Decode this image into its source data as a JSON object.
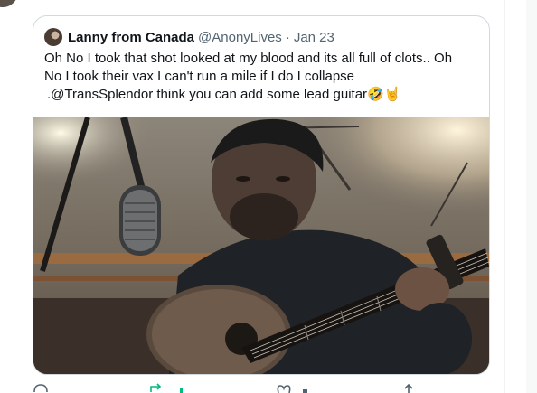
{
  "quoted_tweet": {
    "display_name": "Lanny from Canada",
    "handle": "@AnonyLives",
    "separator": "·",
    "date": "Jan 23",
    "text_lines": [
      "Oh No I took that shot looked at my blood and its all full of clots.. Oh",
      "No I took their vax I can't run a mile if I do I collapse",
      ".@TransSplendor think you can add some lead guitar"
    ],
    "emojis": "🤣🤘"
  },
  "media": {
    "description_icon": "video-thumbnail-man-with-guitar-and-microphone"
  },
  "colors": {
    "border": "#cfd9de",
    "secondary_text": "#536471",
    "retweet_green": "#00ba7c"
  },
  "icons": [
    "reply-icon",
    "retweet-icon",
    "like-icon",
    "share-icon"
  ]
}
